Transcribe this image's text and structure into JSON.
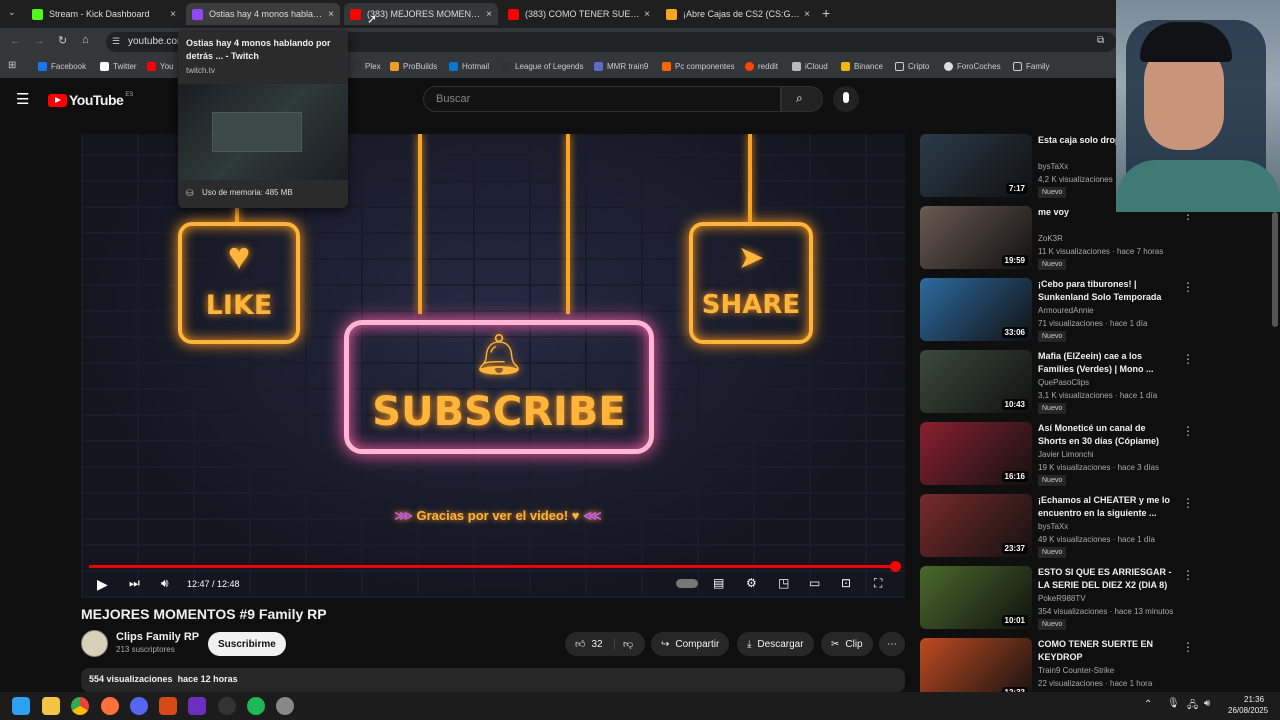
{
  "browser": {
    "tabs": [
      {
        "label": "Stream - Kick Dashboard",
        "color": "#53fc18"
      },
      {
        "label": "Ostias hay 4 monos hablando p",
        "color": "#9146ff"
      },
      {
        "label": "(383) MEJORES MOMENTOS #9",
        "color": "#ff0000"
      },
      {
        "label": "(383) COMO TENER SUERTE EN",
        "color": "#ff0000"
      },
      {
        "label": "¡Abre Cajas de CS2 (CS:GO), Ga",
        "color": "#f5a623"
      }
    ],
    "url": "youtube.com",
    "bookmarks": [
      "Facebook",
      "Twitter",
      "You",
      "Plex",
      "ProBuilds",
      "Hotmail",
      "League of Legends",
      "MMR train9",
      "Pc componentes",
      "reddit",
      "iCloud",
      "Binance",
      "Cripto",
      "ForoCoches",
      "Family"
    ]
  },
  "tooltip": {
    "title": "Ostias hay 4 monos hablando por detrás ... - Twitch",
    "domain": "twitch.tv",
    "memory": "Uso de memoria: 485 MB"
  },
  "youtube": {
    "logo": "YouTube",
    "region": "ES",
    "search_placeholder": "Buscar"
  },
  "video": {
    "like": "LIKE",
    "share": "SHARE",
    "subscribe": "SUBSCRIBE",
    "thanks": "Gracias por ver el video! ♥",
    "time": "12:47 / 12:48",
    "progress": 0.999,
    "title": "MEJORES MOMENTOS #9 Family RP",
    "channel": "Clips Family RP",
    "subscribers": "213 suscriptores",
    "subscribe_btn": "Suscribirme",
    "likes": "32",
    "share_btn": "Compartir",
    "download_btn": "Descargar",
    "clip_btn": "Clip",
    "views": "554 visualizaciones",
    "ago": "hace 12 horas"
  },
  "recs": [
    {
      "title": "Esta caja solo drop Medusa!!!",
      "channel": "bysTaXx",
      "meta": "4,2 K visualizaciones",
      "dur": "7:17",
      "badge": "Nuevo",
      "thumb": "#2a3b4a"
    },
    {
      "title": "me voy",
      "channel": "ZoK3R",
      "meta": "11 K visualizaciones · hace 7 horas",
      "dur": "19:59",
      "badge": "Nuevo",
      "thumb": "#6a5a52"
    },
    {
      "title": "¡Cebo para tiburones! | Sunkenland Solo Temporada 6...",
      "channel": "ArmouredAnnie",
      "meta": "71 visualizaciones · hace 1 día",
      "dur": "33:06",
      "badge": "Nuevo",
      "thumb": "#2d6aa0"
    },
    {
      "title": "Mafia (ElZeein) cae a los Families (Verdes) | Mono ...",
      "channel": "QuePasoClips",
      "meta": "3,1 K visualizaciones · hace 1 día",
      "dur": "10:43",
      "badge": "Nuevo",
      "thumb": "#3b4a3a"
    },
    {
      "title": "Así Moneticé un canal de Shorts en 30 días (Cópiame)",
      "channel": "Javier Limonchi",
      "meta": "19 K visualizaciones · hace 3 días",
      "dur": "16:16",
      "badge": "Nuevo",
      "thumb": "#8a2030"
    },
    {
      "title": "¡Echamos al CHEATER y me lo encuentro en la siguiente ...",
      "channel": "bysTaXx",
      "meta": "49 K visualizaciones · hace 1 día",
      "dur": "23:37",
      "badge": "Nuevo",
      "thumb": "#7a2a2a"
    },
    {
      "title": "ESTO SI QUE ES ARRIESGAR - LA SERIE DEL DIEZ X2 (DIA 8)",
      "channel": "PokeR988TV",
      "meta": "354 visualizaciones · hace 13 minutos",
      "dur": "10:01",
      "badge": "Nuevo",
      "thumb": "#4a6a2a"
    },
    {
      "title": "COMO TENER SUERTE EN KEYDROP",
      "channel": "Train9 Counter-Strike",
      "meta": "22 visualizaciones · hace 1 hora",
      "dur": "12:33",
      "badge": "",
      "thumb": "#c04a20"
    }
  ],
  "taskbar": {
    "time": "21:36",
    "date": "26/08/2025"
  }
}
